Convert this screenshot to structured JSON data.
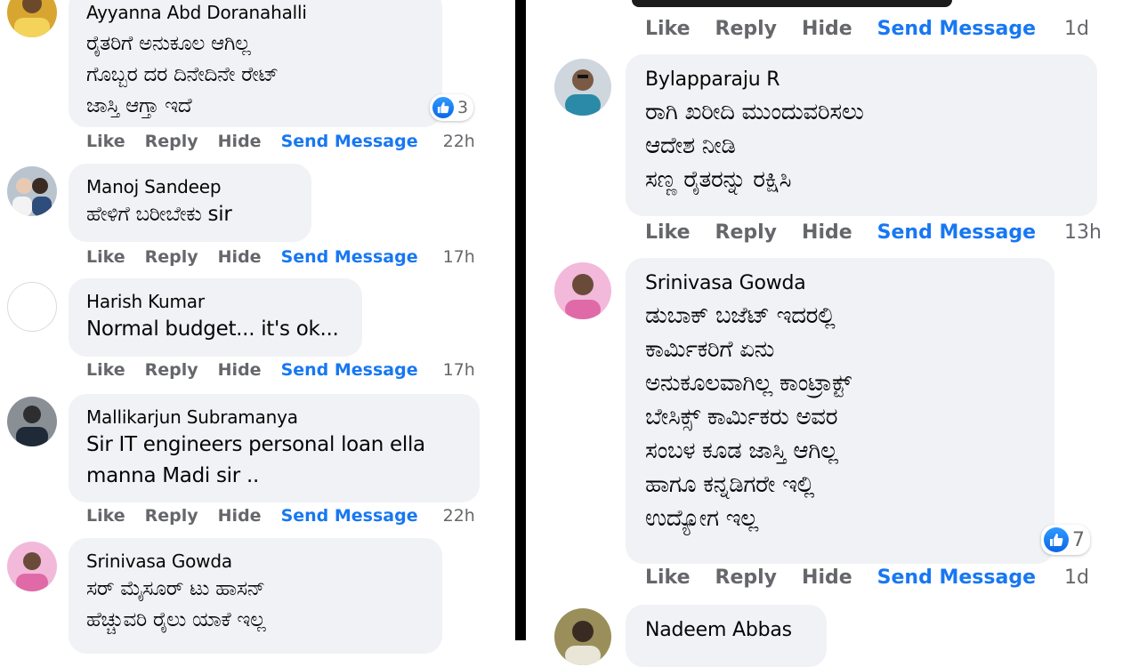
{
  "actions": {
    "like": "Like",
    "reply": "Reply",
    "hide": "Hide",
    "send_message": "Send Message"
  },
  "left_comments": [
    {
      "author": "Ayyanna Abd Doranahalli",
      "text": "ರೈತರಿಗೆ ಅನುಕೂಲ ಆಗಿಲ್ಲ\nಗೊಬ್ಬರ ದರ ದಿನೇದಿನೇ ರೇಟ್\nಜಾಸ್ತಿ ಆಗ್ತಾ ಇದೆ",
      "time": "22h",
      "reaction_count": "3"
    },
    {
      "author": "Manoj Sandeep",
      "text": "ಹೇಳಿಗೆ ಬರೀಬೇಕು sir",
      "time": "17h"
    },
    {
      "author": "Harish Kumar",
      "text": "Normal budget... it's ok...",
      "time": "17h"
    },
    {
      "author": "Mallikarjun Subramanya",
      "text": "Sir IT engineers personal loan ella\nmanna Madi sir ..",
      "time": "22h"
    },
    {
      "author": "Srinivasa Gowda",
      "text": "ಸರ್ ಮೈಸೂರ್ ಟು ಹಾಸನ್\nಹೆಚ್ಚುವರಿ ರೈಲು ಯಾಕೆ ಇಲ್ಲ"
    }
  ],
  "right_comments": [
    {
      "time": "1d"
    },
    {
      "author": "Bylapparaju R",
      "text": "ರಾಗಿ ಖರೀದಿ ಮುಂದುವರಿಸಲು\nಆದೇಶ ನೀಡಿ\nಸಣ್ಣ ರೈತರನ್ನು ರಕ್ಷಿಸಿ",
      "time": "13h"
    },
    {
      "author": "Srinivasa Gowda",
      "text": "ಡುಬಾಕ್ ಬಜೆಟ್ ಇದರಲ್ಲಿ\nಕಾರ್ಮಿಕರಿಗೆ ಏನು\nಅನುಕೂಲವಾಗಿಲ್ಲ ಕಾಂಟ್ರಾಕ್ಟ್\nಬೇಸಿಕ್ಸ್ ಕಾರ್ಮಿಕರು ಅವರ\nಸಂಬಳ ಕೂಡ ಜಾಸ್ತಿ ಆಗಿಲ್ಲ\nಹಾಗೂ ಕನ್ನಡಿಗರೇ ಇಲ್ಲಿ\nಉದ್ಯೋಗ ಇಲ್ಲ",
      "time": "1d",
      "reaction_count": "7"
    },
    {
      "author": "Nadeem Abbas"
    }
  ],
  "colors": {
    "link": "#1877f2",
    "muted": "#65676b",
    "bubble": "#f0f2f5",
    "divider": "#000000"
  }
}
